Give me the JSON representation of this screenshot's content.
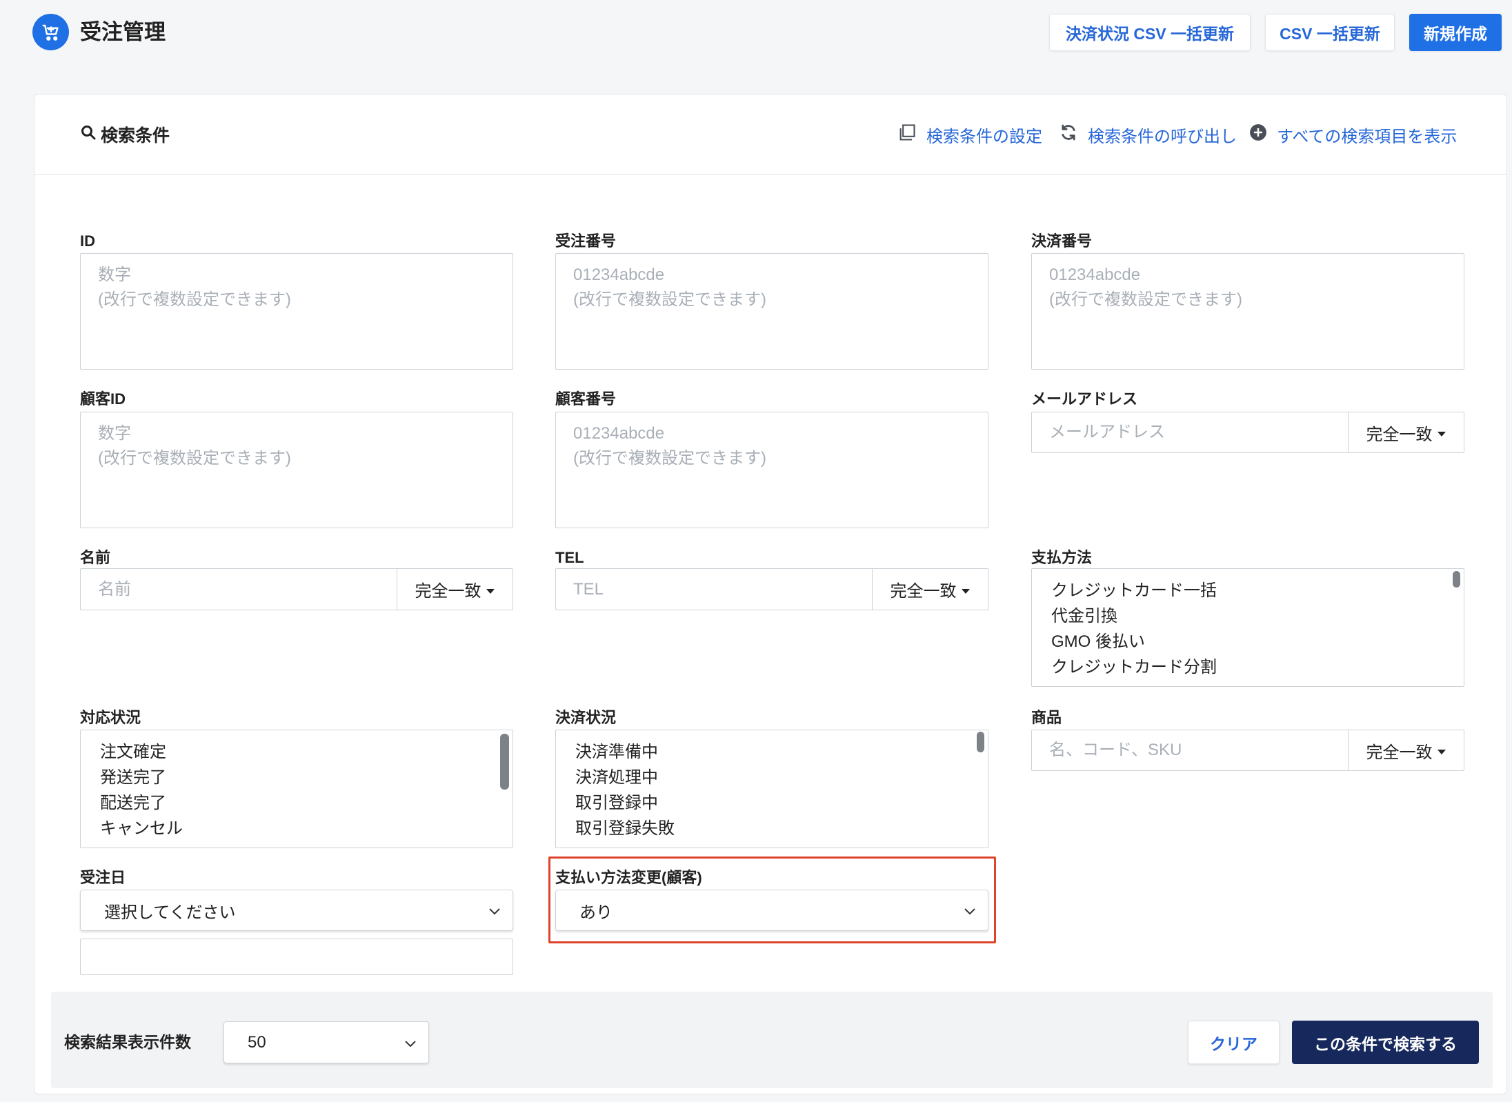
{
  "app": {
    "title": "受注管理",
    "icon": "cart-icon"
  },
  "colors": {
    "primary": "#1f6fe5",
    "link": "#2566d8",
    "navy": "#17295c",
    "highlight": "#e0432c"
  },
  "header": {
    "buttons": {
      "csv_payment": "決済状況 CSV 一括更新",
      "csv_bulk": "CSV 一括更新",
      "new": "新規作成"
    }
  },
  "search": {
    "title": "検索条件",
    "links": {
      "settings": "検索条件の設定",
      "recall": "検索条件の呼び出し",
      "show_all": "すべての検索項目を表示"
    }
  },
  "fields": {
    "id": {
      "label": "ID",
      "placeholder": "数字\n(改行で複数設定できます)"
    },
    "order_number": {
      "label": "受注番号",
      "placeholder": "01234abcde\n(改行で複数設定できます)"
    },
    "payment_number": {
      "label": "決済番号",
      "placeholder": "01234abcde\n(改行で複数設定できます)"
    },
    "customer_id": {
      "label": "顧客ID",
      "placeholder": "数字\n(改行で複数設定できます)"
    },
    "customer_number": {
      "label": "顧客番号",
      "placeholder": "01234abcde\n(改行で複数設定できます)"
    },
    "email": {
      "label": "メールアドレス",
      "placeholder": "メールアドレス",
      "match": "完全一致"
    },
    "name": {
      "label": "名前",
      "placeholder": "名前",
      "match": "完全一致"
    },
    "tel": {
      "label": "TEL",
      "placeholder": "TEL",
      "match": "完全一致"
    },
    "payment_method": {
      "label": "支払方法",
      "options": [
        "クレジットカード一括",
        "代金引換",
        "GMO 後払い",
        "クレジットカード分割"
      ]
    },
    "status": {
      "label": "対応状況",
      "options": [
        "注文確定",
        "発送完了",
        "配送完了",
        "キャンセル"
      ]
    },
    "payment_status": {
      "label": "決済状況",
      "options": [
        "決済準備中",
        "決済処理中",
        "取引登録中",
        "取引登録失敗"
      ]
    },
    "product": {
      "label": "商品",
      "placeholder": "名、コード、SKU",
      "match": "完全一致"
    },
    "order_date": {
      "label": "受注日",
      "value": "選択してください"
    },
    "payment_change": {
      "label": "支払い方法変更(顧客)",
      "value": "あり"
    }
  },
  "footer": {
    "per_page_label": "検索結果表示件数",
    "per_page_value": "50",
    "clear": "クリア",
    "submit": "この条件で検索する"
  }
}
